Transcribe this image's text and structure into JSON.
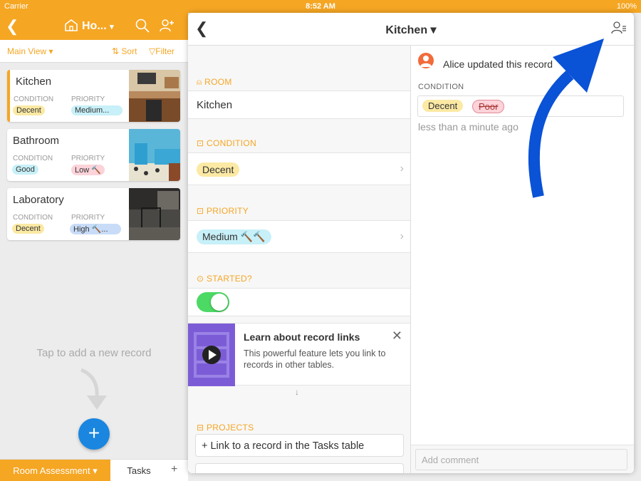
{
  "status": {
    "carrier": "Carrier",
    "time": "8:52 AM",
    "battery": "100%"
  },
  "header": {
    "base_title": "Ho..."
  },
  "toolbar": {
    "view": "Main View ▾",
    "sort": "Sort",
    "filter": "Filter"
  },
  "records": [
    {
      "name": "Kitchen",
      "condition": "Decent",
      "priority": "Medium..."
    },
    {
      "name": "Bathroom",
      "condition": "Good",
      "priority": "Low 🔨"
    },
    {
      "name": "Laboratory",
      "condition": "Decent",
      "priority": "High 🔨..."
    }
  ],
  "card_labels": {
    "condition": "CONDITION",
    "priority": "PRIORITY"
  },
  "empty_hint": "Tap to add a new record",
  "tabs": {
    "active": "Room Assessment ▾",
    "other": "Tasks",
    "add": "+"
  },
  "detail": {
    "title": "Kitchen ▾",
    "fields": {
      "room_label": "ROOM",
      "room_value": "Kitchen",
      "condition_label": "CONDITION",
      "condition_value": "Decent",
      "priority_label": "PRIORITY",
      "priority_value": "Medium 🔨🔨",
      "started_label": "STARTED?",
      "projects_label": "PROJECTS",
      "link_button": "+ Link to a record in the Tasks table"
    },
    "promo": {
      "title": "Learn about record links",
      "description": "This powerful feature lets you link to records in other tables."
    }
  },
  "activity": {
    "text": "Alice updated this record",
    "field_label": "CONDITION",
    "new_value": "Decent",
    "old_value": "Poor",
    "time": "less than a minute ago",
    "comment_placeholder": "Add comment"
  },
  "colors": {
    "accent": "#f5a623",
    "blue": "#1a86e0"
  }
}
